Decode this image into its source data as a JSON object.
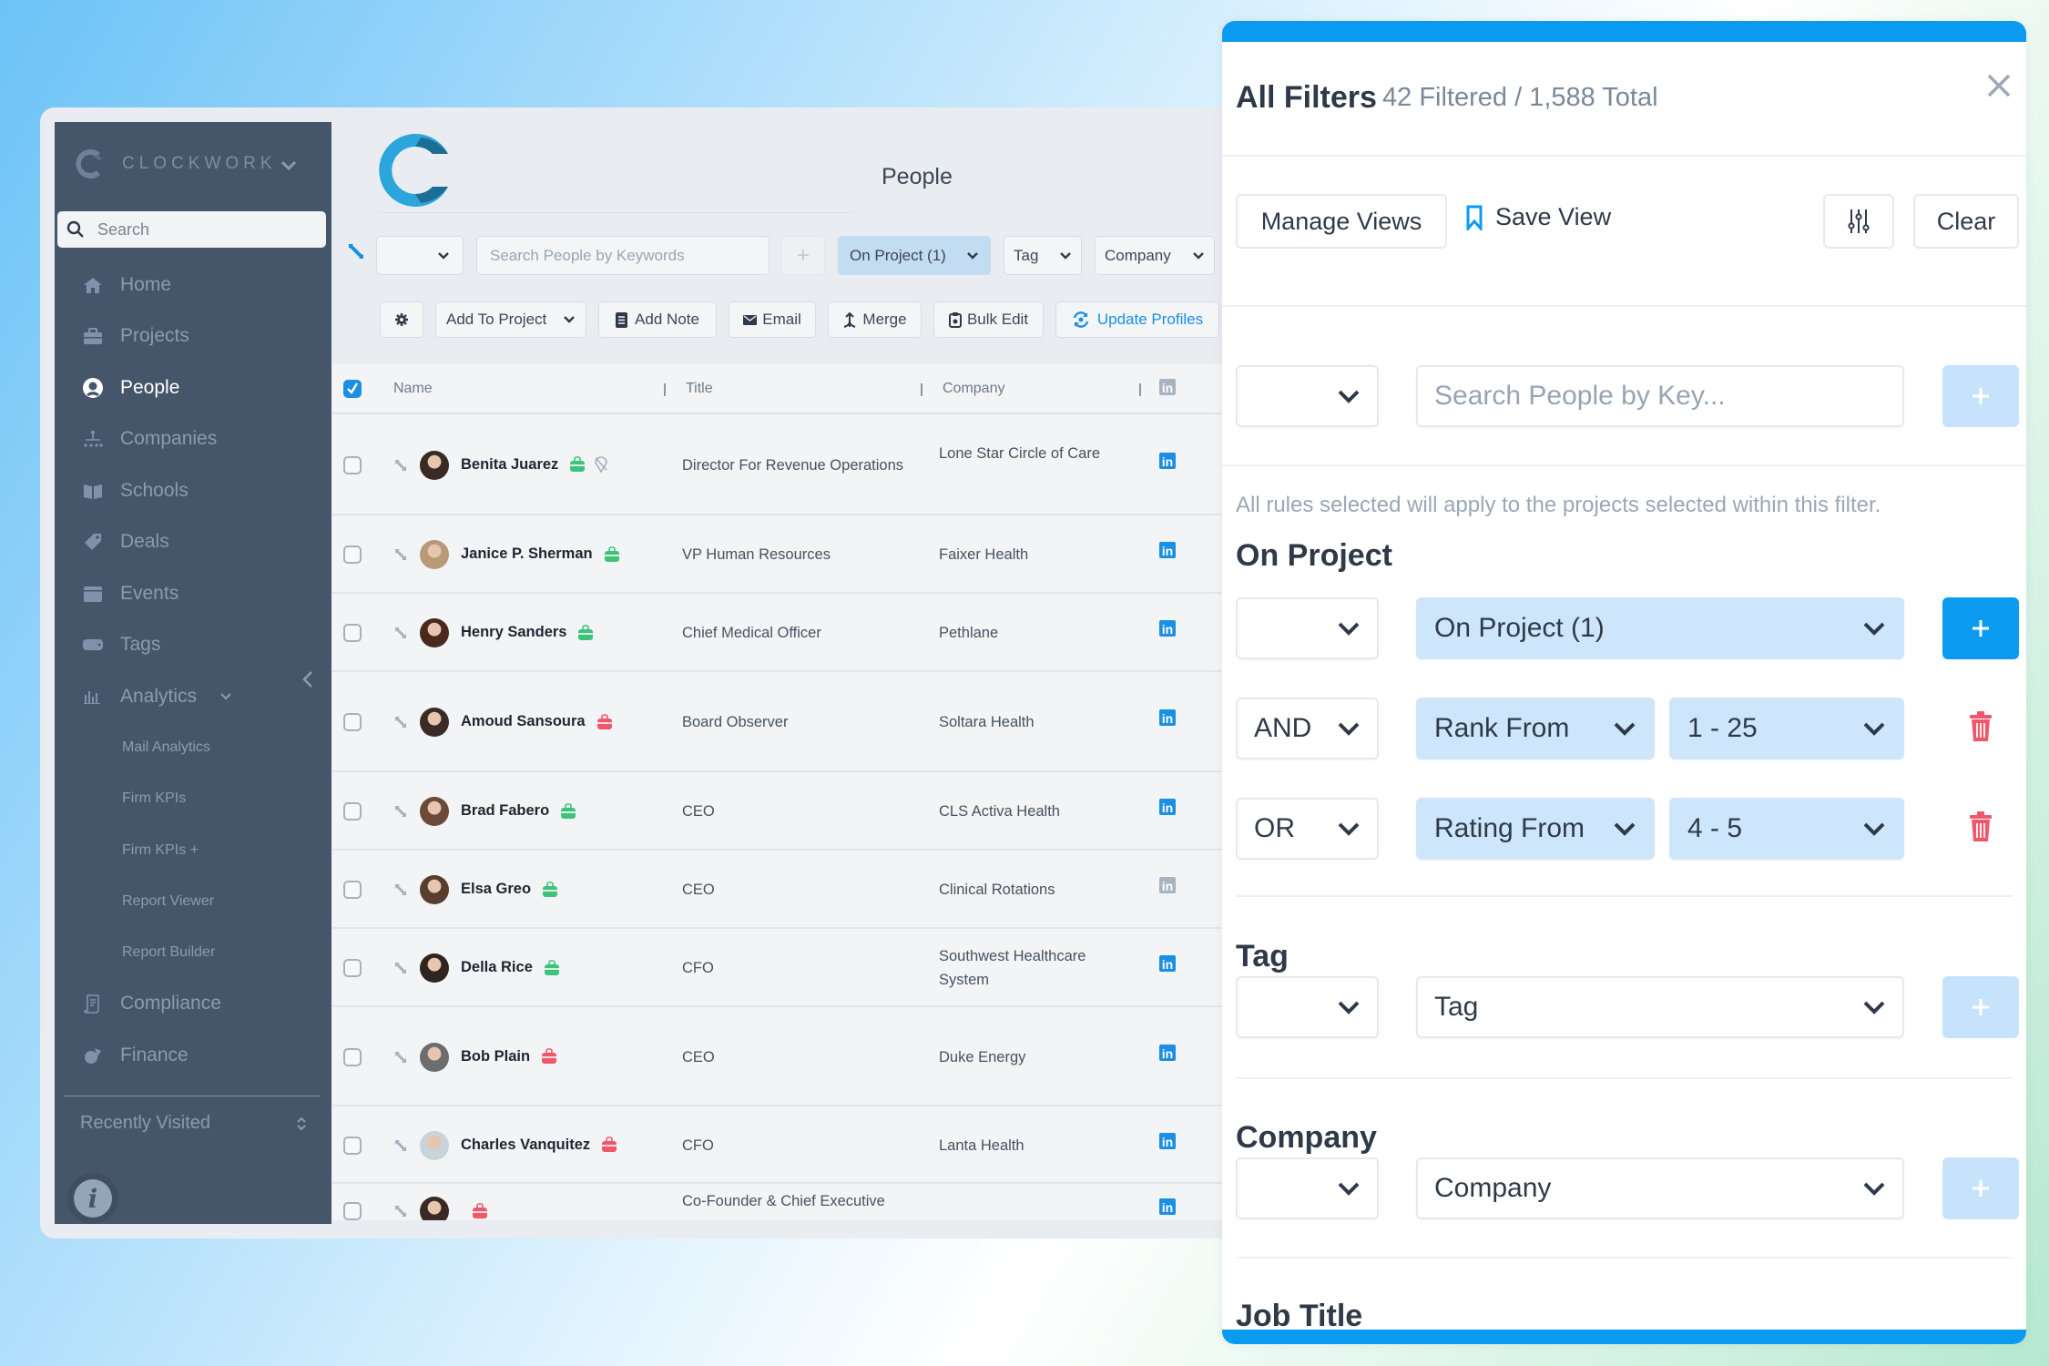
{
  "sidebar": {
    "brand": "CLOCKWORK",
    "search_placeholder": "Search",
    "items": [
      {
        "label": "Home",
        "icon": "home-icon"
      },
      {
        "label": "Projects",
        "icon": "briefcase-icon"
      },
      {
        "label": "People",
        "icon": "person-icon",
        "active": true
      },
      {
        "label": "Companies",
        "icon": "org-chart-icon"
      },
      {
        "label": "Schools",
        "icon": "book-icon"
      },
      {
        "label": "Deals",
        "icon": "tag-icon"
      },
      {
        "label": "Events",
        "icon": "calendar-icon"
      },
      {
        "label": "Tags",
        "icon": "label-icon"
      },
      {
        "label": "Analytics",
        "icon": "bar-chart-icon"
      }
    ],
    "analytics_sub": [
      "Mail Analytics",
      "Firm KPIs",
      "Firm KPIs +",
      "Report Viewer",
      "Report Builder"
    ],
    "items_after": [
      {
        "label": "Compliance",
        "icon": "scroll-icon"
      },
      {
        "label": "Finance",
        "icon": "finance-icon"
      }
    ],
    "recently_visited": "Recently Visited"
  },
  "main": {
    "page_title": "People",
    "search_placeholder": "Search People by Keywords",
    "filter_chips": [
      "On Project (1)",
      "Tag",
      "Company"
    ],
    "actions": {
      "add_to_project": "Add To Project",
      "add_note": "Add Note",
      "email": "Email",
      "merge": "Merge",
      "bulk_edit": "Bulk Edit",
      "update_profiles": "Update Profiles"
    },
    "columns": [
      "Name",
      "Title",
      "Company"
    ],
    "rows": [
      {
        "name": "Benita Juarez",
        "title": "Director For Revenue Operations",
        "company": "Lone Star Circle of Care",
        "bag": "green",
        "extra_pin": true,
        "linkedin": "active"
      },
      {
        "name": "Janice P. Sherman",
        "title": "VP Human Resources",
        "company": "Faixer Health",
        "bag": "green",
        "linkedin": "active"
      },
      {
        "name": "Henry Sanders",
        "title": "Chief Medical Officer",
        "company": "Pethlane",
        "bag": "green",
        "linkedin": "active"
      },
      {
        "name": "Amoud Sansoura",
        "title": "Board Observer",
        "company": "Soltara Health",
        "bag": "red",
        "linkedin": "active"
      },
      {
        "name": "Brad Fabero",
        "title": "CEO",
        "company": "CLS Activa Health",
        "bag": "green",
        "linkedin": "active"
      },
      {
        "name": "Elsa Greo",
        "title": "CEO",
        "company": "Clinical Rotations",
        "bag": "green",
        "linkedin": "inactive"
      },
      {
        "name": "Della Rice",
        "title": "CFO",
        "company": "Southwest Healthcare System",
        "bag": "green",
        "linkedin": "active"
      },
      {
        "name": "Bob Plain",
        "title": "CEO",
        "company": "Duke Energy",
        "bag": "red",
        "linkedin": "active"
      },
      {
        "name": "Charles Vanquitez",
        "title": "CFO",
        "company": "Lanta Health",
        "bag": "red",
        "linkedin": "active"
      },
      {
        "name": "",
        "title": "Co-Founder & Chief Executive",
        "company": "",
        "bag": "red",
        "linkedin": "active"
      }
    ]
  },
  "filters": {
    "title": "All Filters",
    "count": "42 Filtered / 1,588 Total",
    "manage_views": "Manage Views",
    "save_view": "Save View",
    "clear": "Clear",
    "keyword_placeholder": "Search People by Key...",
    "note": "All rules selected will apply to the projects selected within this filter.",
    "sections": {
      "on_project": {
        "heading": "On Project",
        "value": "On Project (1)",
        "rules": [
          {
            "connector": "AND",
            "field": "Rank From",
            "value": "1 - 25"
          },
          {
            "connector": "OR",
            "field": "Rating From",
            "value": "4 - 5"
          }
        ]
      },
      "tag": {
        "heading": "Tag",
        "value": "Tag"
      },
      "company": {
        "heading": "Company",
        "value": "Company"
      },
      "job_title": {
        "heading": "Job Title"
      }
    }
  },
  "colors": {
    "accent": "#0a9bf0",
    "sidebar_bg": "#46566a",
    "chip_blue": "#cde6fb",
    "danger": "#f0576b",
    "success": "#3fc27a"
  }
}
